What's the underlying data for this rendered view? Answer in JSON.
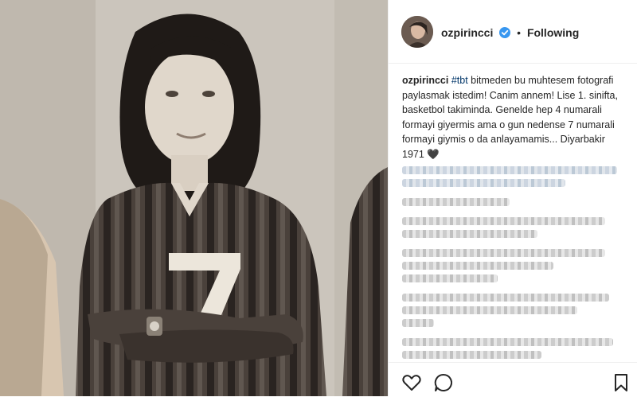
{
  "post": {
    "username": "ozpirincci",
    "separator": "•",
    "follow_status": "Following"
  },
  "caption": {
    "username": "ozpirincci",
    "hashtag": "#tbt",
    "text": " bitmeden bu muhtesem fotografi paylasmak istedim! Canim annem! Lise 1. sinifta, basketbol takiminda. Genelde hep 4 numarali formayi giyermis ama o gun nedense 7 numarali formayi giymis o da anlayamamis... Diyarbakir 1971 🖤"
  },
  "photo": {
    "jersey_number": "7"
  },
  "icons": {
    "verified": "verified-badge-icon",
    "like": "heart-icon",
    "comment": "comment-bubble-icon",
    "save": "bookmark-icon"
  },
  "colors": {
    "verified_blue": "#3897f0",
    "text": "#262626",
    "link": "#003569",
    "divider": "#efefef"
  }
}
